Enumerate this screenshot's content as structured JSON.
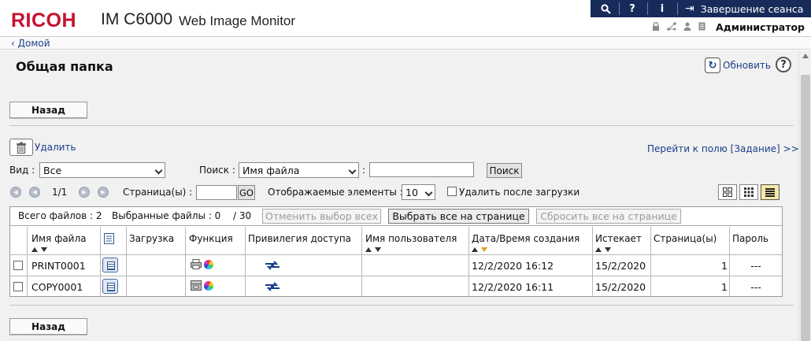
{
  "header": {
    "brand": "RICOH",
    "model": "IM C6000",
    "product": "Web Image Monitor",
    "topbar": {
      "search_icon": "⚲",
      "help_icon": "?",
      "info_icon": "i",
      "logout_icon": "⇥",
      "logout_label": "Завершение сеанса"
    },
    "user": {
      "name": "Администратор",
      "status_icons": [
        "lock-icon",
        "network-icon",
        "user-icon",
        "document-icon"
      ]
    }
  },
  "nav": {
    "home_label": "‹ Домой"
  },
  "page": {
    "title": "Общая папка",
    "refresh_label": "Обновить",
    "help_icon": "?",
    "back_label": "Назад",
    "delete_label": "Удалить",
    "jobs_link": "Перейти к полю [Задание] >>"
  },
  "filters": {
    "view_label": "Вид :",
    "view_value": "Все",
    "search_label": "Поиск :",
    "search_field_value": "Имя файла",
    "search_colon": ":",
    "search_input_value": "",
    "search_button": "Поиск"
  },
  "pagination": {
    "current": "1/1",
    "page_label": "Страница(ы) :",
    "page_input_value": "",
    "go_button": "GO",
    "items_label": "Отображаемые элементы :",
    "items_value": "10",
    "delete_after_download_label": "Удалить после загрузки",
    "delete_after_download_checked": false,
    "view_modes": [
      "grid-large-icon",
      "grid-small-icon",
      "list-view-icon"
    ],
    "active_view_mode": "list-view-icon"
  },
  "table": {
    "total_files": "Всего файлов : 2",
    "selected_files": "Выбранные файлы : 0",
    "max_selectable": "/ 30",
    "cancel_all_label": "Отменить выбор всех",
    "select_page_label": "Выбрать все на странице",
    "reset_page_label": "Сбросить все на странице",
    "columns": [
      "Имя файла",
      "Загрузка",
      "Функция",
      "Привилегия доступа",
      "Имя пользователя",
      "Дата/Время создания",
      "Истекает",
      "Страница(ы)",
      "Пароль"
    ],
    "rows": [
      {
        "file_name": "PRINT0001",
        "function_icons": [
          "printer-icon",
          "color-icon"
        ],
        "user_name": "",
        "created": "12/2/2020 16:12",
        "expires": "15/2/2020",
        "pages": "1",
        "password": "---"
      },
      {
        "file_name": "COPY0001",
        "function_icons": [
          "copier-icon",
          "color-icon"
        ],
        "user_name": "",
        "created": "12/2/2020 16:11",
        "expires": "15/2/2020",
        "pages": "1",
        "password": "---"
      }
    ]
  },
  "colors": {
    "brand_red": "#c8102e",
    "topbar_navy": "#172a5a",
    "link_blue": "#1a3e8c",
    "active_view": "#f6e9a5"
  }
}
